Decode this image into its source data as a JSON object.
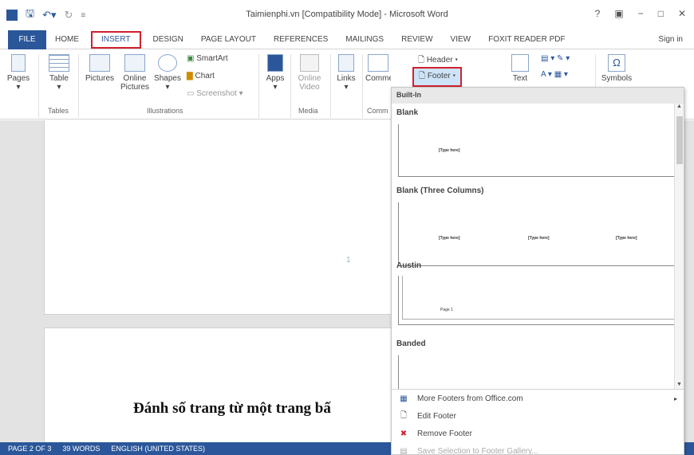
{
  "window": {
    "title": "Taimienphi.vn [Compatibility Mode] - Microsoft Word",
    "help": "?",
    "controls": [
      "−",
      "□",
      "✕"
    ]
  },
  "tabs": [
    {
      "label": "FILE"
    },
    {
      "label": "HOME"
    },
    {
      "label": "INSERT"
    },
    {
      "label": "DESIGN"
    },
    {
      "label": "PAGE LAYOUT"
    },
    {
      "label": "REFERENCES"
    },
    {
      "label": "MAILINGS"
    },
    {
      "label": "REVIEW"
    },
    {
      "label": "VIEW"
    },
    {
      "label": "FOXIT READER PDF"
    }
  ],
  "signin": "Sign in",
  "ribbon": {
    "pages": "Pages",
    "table": "Table",
    "pictures": "Pictures",
    "online_pictures": "Online Pictures",
    "shapes": "Shapes",
    "smartart": "SmartArt",
    "chart": "Chart",
    "screenshot": "Screenshot",
    "apps": "Apps",
    "online_video": "Online Video",
    "links": "Links",
    "comment": "Comment",
    "header": "Header",
    "footer": "Footer",
    "text": "Text",
    "symbols": "Symbols",
    "groups": {
      "tables": "Tables",
      "illustrations": "Illustrations",
      "media": "Media",
      "comments": "Comm"
    }
  },
  "document": {
    "page_number": "1",
    "heading": "Đánh số trang từ một trang bấ"
  },
  "footer_menu": {
    "header": "Built-In",
    "sections": [
      {
        "name": "Blank",
        "placeholders": [
          "[Type here]"
        ]
      },
      {
        "name": "Blank (Three Columns)",
        "placeholders": [
          "[Type here]",
          "[Type here]",
          "[Type here]"
        ]
      },
      {
        "name": "Austin",
        "placeholders": [
          "Page 1"
        ]
      },
      {
        "name": "Banded",
        "placeholders": []
      }
    ],
    "items": [
      {
        "label": "More Footers from Office.com",
        "enabled": true
      },
      {
        "label": "Edit Footer",
        "enabled": true
      },
      {
        "label": "Remove Footer",
        "enabled": true
      },
      {
        "label": "Save Selection to Footer Gallery...",
        "enabled": false
      }
    ]
  },
  "status": {
    "page": "PAGE 2 OF 3",
    "words": "39 WORDS",
    "language": "ENGLISH (UNITED STATES)"
  },
  "colors": {
    "word_blue": "#2b579a",
    "highlight_red": "#d0202e"
  }
}
